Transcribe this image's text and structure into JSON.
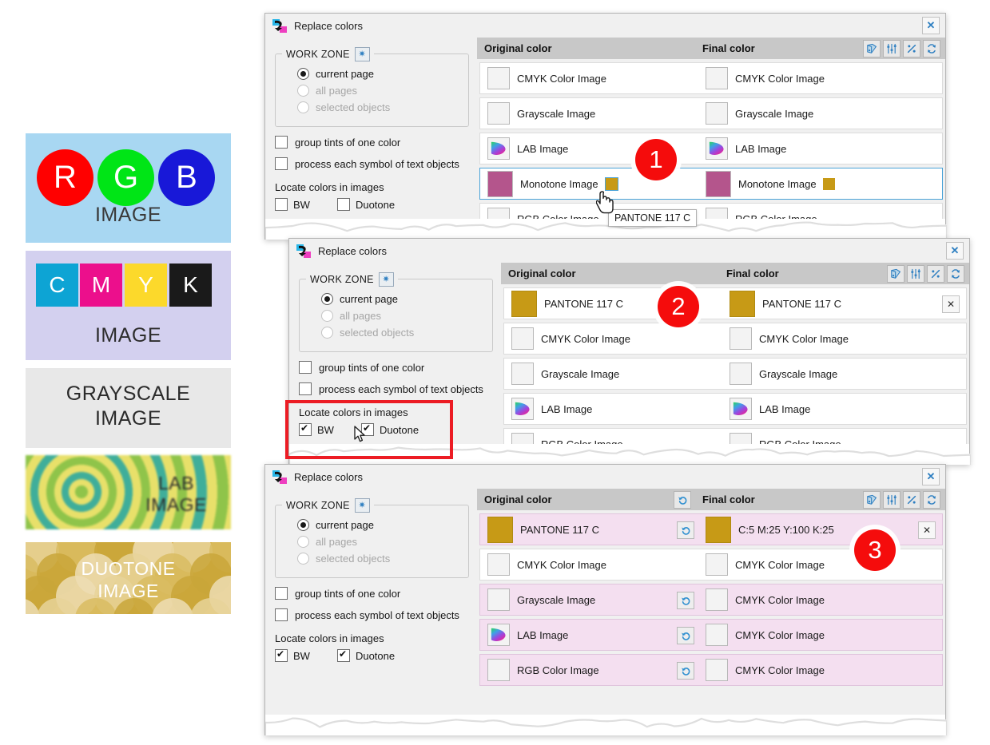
{
  "samples": [
    {
      "name": "rgb",
      "caption": "IMAGE",
      "letters": [
        "R",
        "G",
        "B"
      ],
      "colors": [
        "#ff0000",
        "#00e516",
        "#1818d8"
      ],
      "background": "#a8d7f2"
    },
    {
      "name": "cmyk",
      "caption": "IMAGE",
      "letters": [
        "C",
        "M",
        "Y",
        "K"
      ],
      "colors": [
        "#0da4d4",
        "#ec0f8c",
        "#fcd92b",
        "#1a1a1a"
      ],
      "background": "#d3d0ef"
    },
    {
      "name": "grayscale",
      "caption_line1": "GRAYSCALE",
      "caption_line2": "IMAGE",
      "background": "#e8e8e8"
    },
    {
      "name": "lab",
      "caption_line1": "LAB",
      "caption_line2": "IMAGE",
      "background": "#8fc44a"
    },
    {
      "name": "duotone",
      "caption_line1": "DUOTONE",
      "caption_line2": "IMAGE",
      "background": "#d4ac3e"
    }
  ],
  "colors": {
    "pantone117c": "#c79a16",
    "monotone": "#b4558c",
    "accent_blue": "#2e7fc1",
    "badge_red": "#f50c0c",
    "highlight_red": "#ec1c24",
    "changed_row_bg": "#f4dff0",
    "header_gray": "#c8c8c8"
  },
  "dialog_common": {
    "title": "Replace colors",
    "app_icon": "replace-colors-icon",
    "close_label": "✕",
    "workzone": {
      "legend": "WORK ZONE",
      "gear_icon": "gear-icon",
      "options": [
        {
          "label": "current page",
          "checked": true,
          "disabled": false
        },
        {
          "label": "all pages",
          "checked": false,
          "disabled": true
        },
        {
          "label": "selected objects",
          "checked": false,
          "disabled": true
        }
      ]
    },
    "checkboxes": [
      {
        "label": "group tints of one color",
        "checked": false
      },
      {
        "label": "process each symbol of text objects",
        "checked": false
      }
    ],
    "locate_title": "Locate colors in images",
    "locate_options": [
      {
        "label": "BW",
        "checked": false
      },
      {
        "label": "Duotone",
        "checked": false
      }
    ],
    "list_header": {
      "original": "Original color",
      "final": "Final color",
      "tools": [
        "palette-book-icon",
        "sliders-icon",
        "percent-icon",
        "refresh-icon"
      ]
    }
  },
  "dialog1": {
    "badge": "1",
    "locate_options": [
      {
        "label": "BW",
        "checked": false
      },
      {
        "label": "Duotone",
        "checked": false
      }
    ],
    "tooltip": "PANTONE 117 C",
    "rows": [
      {
        "icon": "cmyk-venn-icon",
        "original": "CMYK Color Image",
        "final": "CMYK Color Image",
        "selected": false,
        "changed": false,
        "swatch": null
      },
      {
        "icon": "grayscale-gradient-icon",
        "original": "Grayscale Image",
        "final": "Grayscale Image",
        "selected": false,
        "changed": false,
        "swatch": null
      },
      {
        "icon": "lab-gamut-icon",
        "original": "LAB Image",
        "final": "LAB Image",
        "selected": false,
        "changed": false,
        "swatch": null
      },
      {
        "icon": "monotone-swatch-icon",
        "original": "Monotone Image",
        "final": "Monotone Image",
        "selected": true,
        "changed": false,
        "swatch": "#c79a16"
      },
      {
        "icon": "rgb-venn-icon",
        "original": "RGB Color Image",
        "final": "RGB Color Image",
        "selected": false,
        "changed": false,
        "swatch": null
      }
    ]
  },
  "dialog2": {
    "badge": "2",
    "locate_options": [
      {
        "label": "BW",
        "checked": true
      },
      {
        "label": "Duotone",
        "checked": true
      }
    ],
    "rows": [
      {
        "icon": "pantone-swatch-icon",
        "original": "PANTONE 117 C",
        "final": "PANTONE 117 C",
        "has_close": true
      },
      {
        "icon": "cmyk-venn-icon",
        "original": "CMYK Color Image",
        "final": "CMYK Color Image",
        "has_close": false
      },
      {
        "icon": "grayscale-gradient-icon",
        "original": "Grayscale Image",
        "final": "Grayscale Image",
        "has_close": false
      },
      {
        "icon": "lab-gamut-icon",
        "original": "LAB Image",
        "final": "LAB Image",
        "has_close": false
      },
      {
        "icon": "rgb-venn-icon",
        "original": "RGB Color Image",
        "final": "RGB Color Image",
        "has_close": false
      }
    ]
  },
  "dialog3": {
    "badge": "3",
    "locate_options": [
      {
        "label": "BW",
        "checked": true
      },
      {
        "label": "Duotone",
        "checked": true
      }
    ],
    "header_undo_icon": "undo-icon",
    "rows": [
      {
        "icon": "pantone-swatch-icon",
        "original": "PANTONE 117 C",
        "final_icon": "pantone-swatch-icon",
        "final": "C:5 M:25 Y:100 K:25",
        "changed": true,
        "undo": true,
        "has_close": true
      },
      {
        "icon": "cmyk-venn-icon",
        "original": "CMYK Color Image",
        "final_icon": "cmyk-venn-icon",
        "final": "CMYK Color Image",
        "changed": false,
        "undo": false,
        "has_close": false
      },
      {
        "icon": "grayscale-gradient-icon",
        "original": "Grayscale Image",
        "final_icon": "cmyk-venn-icon",
        "final": "CMYK Color Image",
        "changed": true,
        "undo": true,
        "has_close": false
      },
      {
        "icon": "lab-gamut-icon",
        "original": "LAB Image",
        "final_icon": "cmyk-venn-icon",
        "final": "CMYK Color Image",
        "changed": true,
        "undo": true,
        "has_close": false
      },
      {
        "icon": "rgb-venn-icon",
        "original": "RGB Color Image",
        "final_icon": "cmyk-venn-icon",
        "final": "CMYK Color Image",
        "changed": true,
        "undo": true,
        "has_close": false
      }
    ]
  }
}
